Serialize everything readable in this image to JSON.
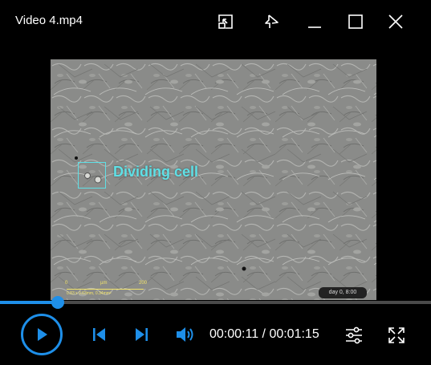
{
  "window": {
    "title": "Video 4.mp4"
  },
  "video": {
    "annotation_label": "Dividing cell",
    "scale": {
      "start": "0",
      "mid": "µm",
      "end": "200",
      "info": "0.83 x 0.63mm, 0.34mm²"
    },
    "timestamp_badge": "day 0, 8:00"
  },
  "playback": {
    "progress_fraction": 0.135,
    "current_time": "00:00:11",
    "separator": " / ",
    "total_time": "00:01:15"
  },
  "colors": {
    "accent": "#1e8fe9",
    "annotation": "#5fe0e6",
    "scale": "#f1e36b"
  },
  "icons": {
    "titlebar": [
      "compact-mode-icon",
      "pin-icon",
      "minimize-icon",
      "maximize-icon",
      "close-icon"
    ],
    "controls": [
      "play-icon",
      "previous-icon",
      "next-icon",
      "volume-icon",
      "settings-sliders-icon",
      "fullscreen-icon"
    ]
  }
}
